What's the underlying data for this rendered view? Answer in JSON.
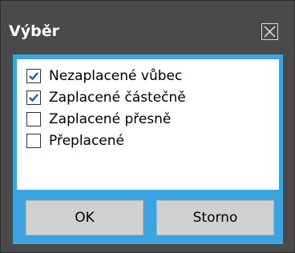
{
  "dialog": {
    "title": "Výběr",
    "close_icon": "close-icon"
  },
  "options": [
    {
      "label": "Nezaplacené vůbec",
      "checked": true
    },
    {
      "label": "Zaplacené částečně",
      "checked": true
    },
    {
      "label": "Zaplacené přesně",
      "checked": false
    },
    {
      "label": "Přeplacené",
      "checked": false
    }
  ],
  "buttons": {
    "ok_label": "OK",
    "cancel_label": "Storno"
  },
  "colors": {
    "background": "#4a4a4a",
    "accent": "#3aa3e0",
    "button": "#d0d0d0"
  }
}
